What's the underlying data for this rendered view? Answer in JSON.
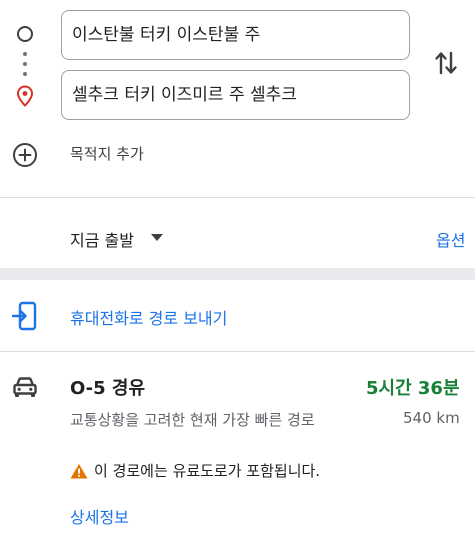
{
  "route_inputs": {
    "origin": "이스탄불 터키 이스탄불 주",
    "destination": "셀추크 터키 이즈미르 주 셀추크"
  },
  "add_destination_label": "목적지 추가",
  "departure": {
    "label": "지금 출발",
    "options_label": "옵션"
  },
  "send_to_phone_label": "휴대전화로 경로 보내기",
  "route": {
    "name": "O-5 경유",
    "duration": "5시간 36분",
    "description": "교통상황을 고려한 현재 가장 빠른 경로",
    "distance": "540 km",
    "warning": "이 경로에는 유료도로가 포함됩니다.",
    "details_label": "상세정보"
  },
  "colors": {
    "accent": "#1a73e8",
    "duration": "#188038",
    "warning": "#e37400",
    "destination_pin": "#d93025"
  },
  "icons": [
    "origin-circle-icon",
    "destination-pin-icon",
    "swap-icon",
    "add-circle-icon",
    "dropdown-arrow-icon",
    "send-to-phone-icon",
    "car-icon",
    "warning-icon"
  ]
}
